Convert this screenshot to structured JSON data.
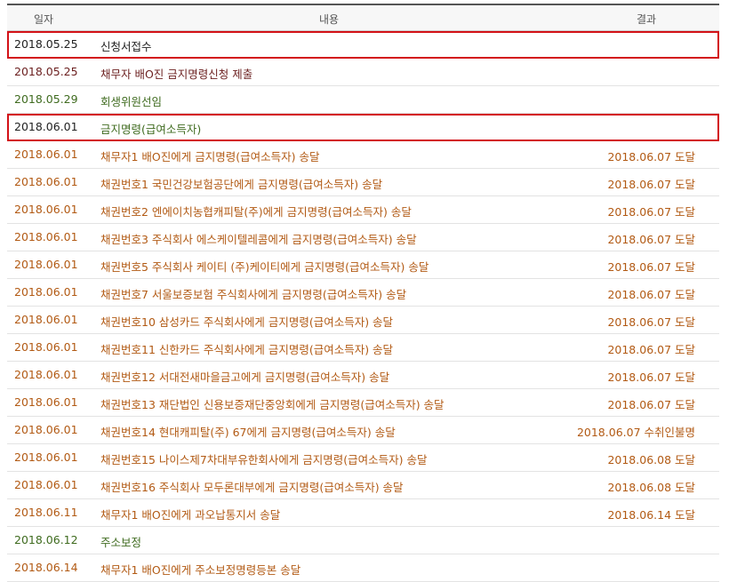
{
  "colors": {
    "black": "#222222",
    "maroon": "#6b1f1f",
    "green": "#3f6b1f",
    "orange": "#b25a14",
    "highlight": "#d31117"
  },
  "header": {
    "date": "일자",
    "content": "내용",
    "result": "결과"
  },
  "rows": [
    {
      "date": "2018.05.25",
      "content": "신청서접수",
      "result": "",
      "color": "#222222",
      "highlight": true
    },
    {
      "date": "2018.05.25",
      "content": "채무자 배O진 금지명령신청 제출",
      "result": "",
      "color": "#6b1f1f",
      "highlight": false
    },
    {
      "date": "2018.05.29",
      "content": "회생위원선임",
      "result": "",
      "color": "#3f6b1f",
      "highlight": false
    },
    {
      "date": "2018.06.01",
      "content": "금지명령(급여소득자)",
      "result": "",
      "color": "#3f6b1f",
      "highlight": true
    },
    {
      "date": "2018.06.01",
      "content": "채무자1 배O진에게 금지명령(급여소득자) 송달",
      "result": "2018.06.07 도달",
      "color": "#b25a14",
      "highlight": false
    },
    {
      "date": "2018.06.01",
      "content": "채권번호1 국민건강보험공단에게 금지명령(급여소득자) 송달",
      "result": "2018.06.07 도달",
      "color": "#b25a14",
      "highlight": false
    },
    {
      "date": "2018.06.01",
      "content": "채권번호2 엔에이치농협캐피탈(주)에게 금지명령(급여소득자) 송달",
      "result": "2018.06.07 도달",
      "color": "#b25a14",
      "highlight": false
    },
    {
      "date": "2018.06.01",
      "content": "채권번호3 주식회사 에스케이텔레콤에게 금지명령(급여소득자) 송달",
      "result": "2018.06.07 도달",
      "color": "#b25a14",
      "highlight": false
    },
    {
      "date": "2018.06.01",
      "content": "채권번호5 주식회사 케이티 (주)케이티에게 금지명령(급여소득자) 송달",
      "result": "2018.06.07 도달",
      "color": "#b25a14",
      "highlight": false
    },
    {
      "date": "2018.06.01",
      "content": "채권번호7 서울보증보험 주식회사에게 금지명령(급여소득자) 송달",
      "result": "2018.06.07 도달",
      "color": "#b25a14",
      "highlight": false
    },
    {
      "date": "2018.06.01",
      "content": "채권번호10 삼성카드 주식회사에게 금지명령(급여소득자) 송달",
      "result": "2018.06.07 도달",
      "color": "#b25a14",
      "highlight": false
    },
    {
      "date": "2018.06.01",
      "content": "채권번호11 신한카드 주식회사에게 금지명령(급여소득자) 송달",
      "result": "2018.06.07 도달",
      "color": "#b25a14",
      "highlight": false
    },
    {
      "date": "2018.06.01",
      "content": "채권번호12 서대전새마을금고에게 금지명령(급여소득자) 송달",
      "result": "2018.06.07 도달",
      "color": "#b25a14",
      "highlight": false
    },
    {
      "date": "2018.06.01",
      "content": "채권번호13 재단법인 신용보증재단중앙회에게 금지명령(급여소득자) 송달",
      "result": "2018.06.07 도달",
      "color": "#b25a14",
      "highlight": false
    },
    {
      "date": "2018.06.01",
      "content": "채권번호14 현대캐피탈(주) 67에게 금지명령(급여소득자) 송달",
      "result": "2018.06.07 수취인불명",
      "color": "#b25a14",
      "highlight": false
    },
    {
      "date": "2018.06.01",
      "content": "채권번호15 나이스제7차대부유한회사에게 금지명령(급여소득자) 송달",
      "result": "2018.06.08 도달",
      "color": "#b25a14",
      "highlight": false
    },
    {
      "date": "2018.06.01",
      "content": "채권번호16 주식회사 모두론대부에게 금지명령(급여소득자) 송달",
      "result": "2018.06.08 도달",
      "color": "#b25a14",
      "highlight": false
    },
    {
      "date": "2018.06.11",
      "content": "채무자1 배O진에게 과오납통지서 송달",
      "result": "2018.06.14 도달",
      "color": "#b25a14",
      "highlight": false
    },
    {
      "date": "2018.06.12",
      "content": "주소보정",
      "result": "",
      "color": "#3f6b1f",
      "highlight": false
    },
    {
      "date": "2018.06.14",
      "content": "채무자1 배O진에게 주소보정명령등본 송달",
      "result": "",
      "color": "#b25a14",
      "highlight": false
    }
  ]
}
